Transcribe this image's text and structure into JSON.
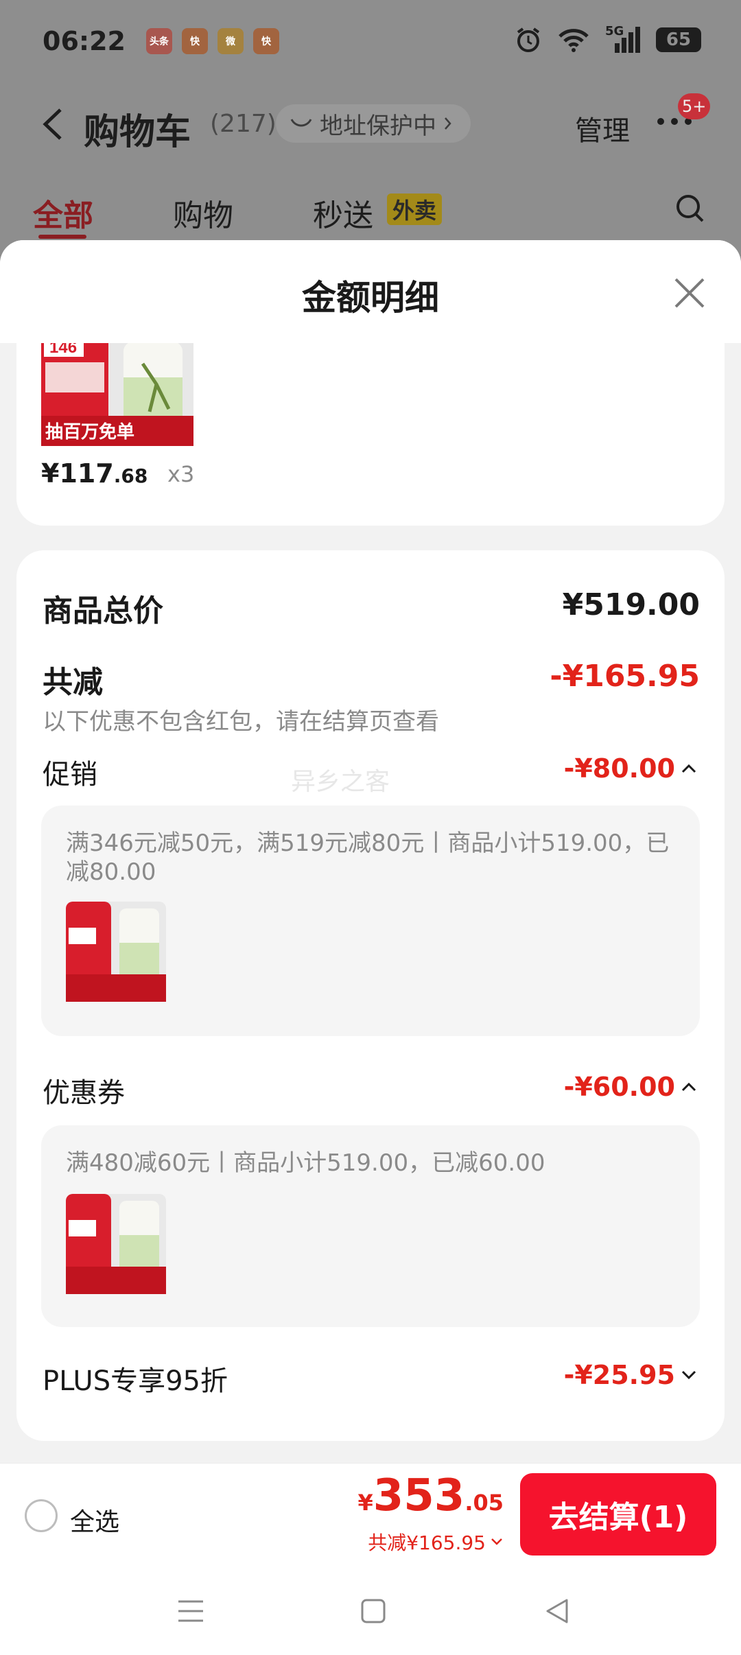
{
  "status_bar": {
    "time": "06:22",
    "notifications": [
      {
        "name": "toutiao-icon",
        "label": "头条",
        "color": "#d0453d"
      },
      {
        "name": "kuaishou-icon-1",
        "label": "快",
        "color": "#c55a22"
      },
      {
        "name": "weibo-icon",
        "label": "微",
        "color": "#c8922a"
      },
      {
        "name": "kuaishou-icon-2",
        "label": "快",
        "color": "#c55a22"
      }
    ],
    "network": "5G",
    "battery": "65"
  },
  "cart": {
    "title": "购物车",
    "count": "(217)",
    "address_label": "地址保护中",
    "manage_label": "管理",
    "more_badge": "5+",
    "tabs": [
      {
        "label": "全部"
      },
      {
        "label": "购物"
      },
      {
        "label": "秒送"
      }
    ],
    "waimai_tag": "外卖"
  },
  "sheet": {
    "title": "金额明细",
    "product": {
      "price_int": "¥117",
      "price_dec": ".68",
      "qty": "x3",
      "thumb_text": "抽百万免单",
      "thumb_badge": "146"
    },
    "total_label": "商品总价",
    "total_value": "¥519.00",
    "discount_label": "共减",
    "discount_value": "-¥165.95",
    "note": "以下优惠不包含红包，请在结算页查看",
    "watermark": "异乡之客",
    "promo": {
      "label": "促销",
      "value": "-¥80.00",
      "detail": "满346元减50元，满519元减80元丨商品小计519.00，已减80.00"
    },
    "coupon": {
      "label": "优惠券",
      "value": "-¥60.00",
      "detail": "满480减60元丨商品小计519.00，已减60.00"
    },
    "plus": {
      "label": "PLUS专享95折",
      "value": "-¥25.95"
    }
  },
  "bottom": {
    "select_all": "全选",
    "total_yen": "¥",
    "total_int": "353",
    "total_dec": ".05",
    "total_discount": "共减¥165.95",
    "checkout": "去结算(1)"
  },
  "colors": {
    "accent_red": "#e2231a",
    "checkout_red": "#f5132d",
    "overlay": "#8e8e8e"
  }
}
